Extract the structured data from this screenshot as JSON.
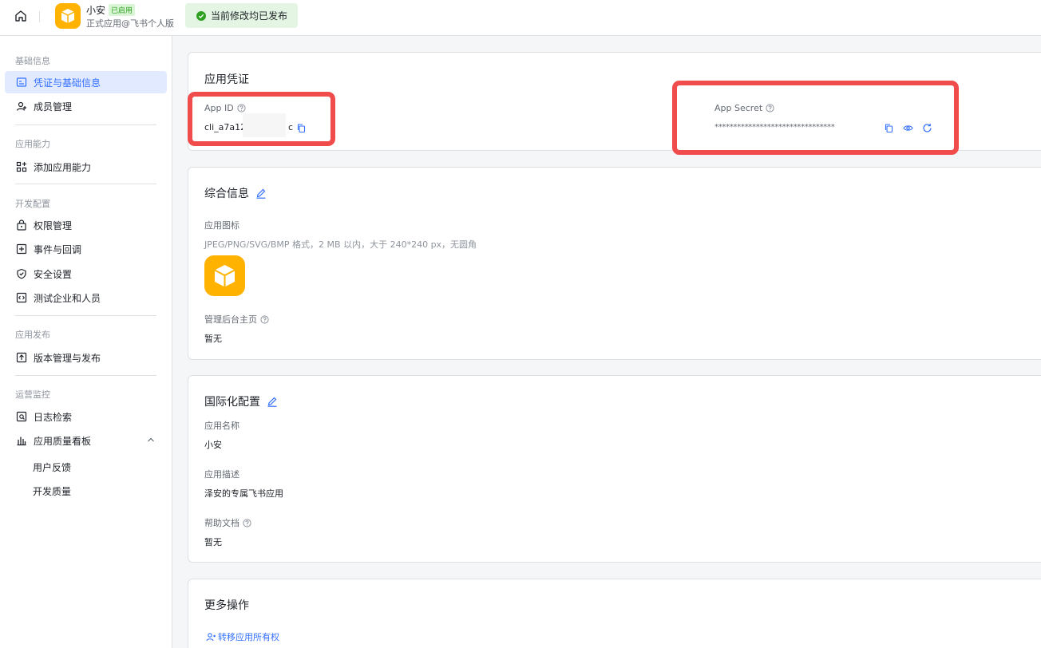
{
  "topbar": {
    "app_name": "小安",
    "app_badge": "已启用",
    "app_subtitle": "正式应用@飞书个人版",
    "publish_status": "当前修改均已发布"
  },
  "sidebar": {
    "groups": [
      {
        "title": "基础信息",
        "items": [
          "凭证与基础信息",
          "成员管理"
        ]
      },
      {
        "title": "应用能力",
        "items": [
          "添加应用能力"
        ]
      },
      {
        "title": "开发配置",
        "items": [
          "权限管理",
          "事件与回调",
          "安全设置",
          "测试企业和人员"
        ]
      },
      {
        "title": "应用发布",
        "items": [
          "版本管理与发布"
        ]
      },
      {
        "title": "运营监控",
        "items": [
          "日志检索",
          "应用质量看板"
        ]
      }
    ],
    "sub_items": [
      "用户反馈",
      "开发质量"
    ],
    "active_item": "凭证与基础信息"
  },
  "credentials": {
    "title": "应用凭证",
    "app_id_label": "App ID",
    "app_id_value_prefix": "cli_a7a12",
    "app_id_value_suffix": "c",
    "app_secret_label": "App Secret",
    "app_secret_value": "********************************"
  },
  "general": {
    "title": "综合信息",
    "icon_label": "应用图标",
    "icon_hint": "JPEG/PNG/SVG/BMP 格式，2 MB 以内，大于 240*240 px，无圆角",
    "admin_home_label": "管理后台主页",
    "admin_home_value": "暂无"
  },
  "i18n": {
    "title": "国际化配置",
    "name_label": "应用名称",
    "name_value": "小安",
    "desc_label": "应用描述",
    "desc_value": "泽安的专属飞书应用",
    "help_label": "帮助文档",
    "help_value": "暂无"
  },
  "more": {
    "title": "更多操作",
    "transfer_link": "转移应用所有权"
  },
  "colors": {
    "accent": "#3370ff",
    "highlight": "#f04c4c",
    "success": "#2ea121",
    "logo": "#ffb300"
  }
}
